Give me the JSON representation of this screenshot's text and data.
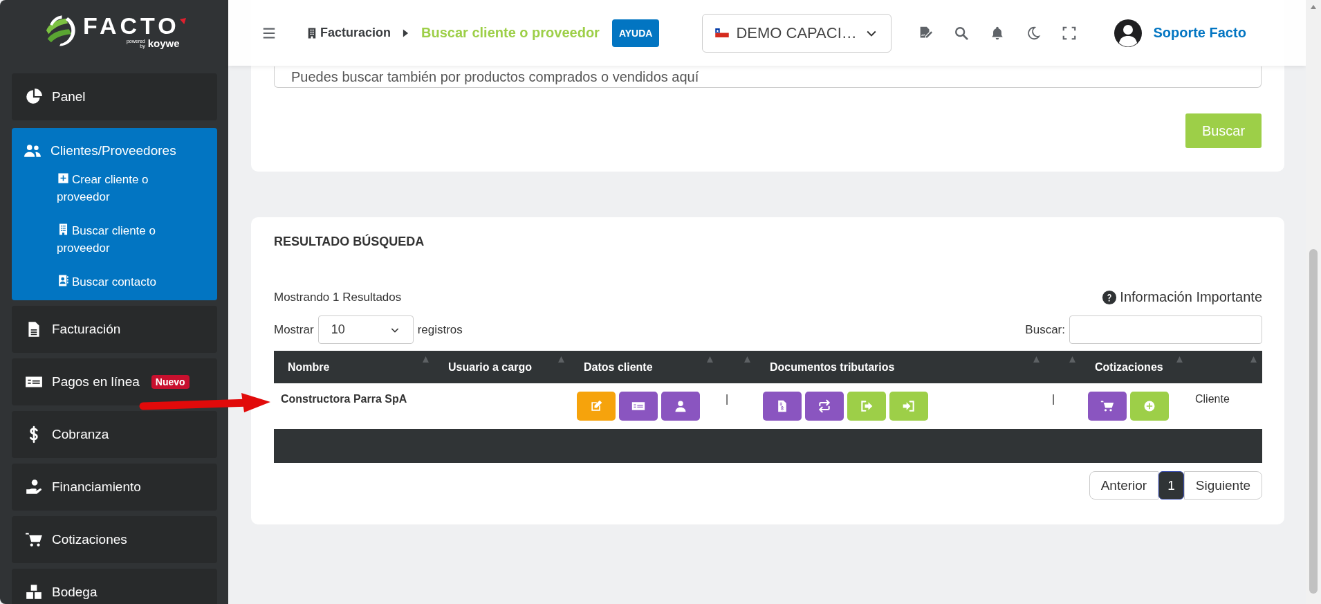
{
  "logo": {
    "name": "FACTO",
    "powered": "powered by",
    "brand": "koywe"
  },
  "sidebar": {
    "items": [
      {
        "label": "Panel",
        "selected": false,
        "expanded": false
      },
      {
        "label": "Clientes/Proveedores",
        "selected": true,
        "expanded": true,
        "children": [
          {
            "label": "Crear cliente o proveedor"
          },
          {
            "label": "Buscar cliente o proveedor"
          },
          {
            "label": "Buscar contacto"
          }
        ]
      },
      {
        "label": "Facturación",
        "selected": false,
        "expanded": false
      },
      {
        "label": "Pagos en línea",
        "selected": false,
        "expanded": false,
        "badge": "Nuevo"
      },
      {
        "label": "Cobranza",
        "selected": false,
        "expanded": false
      },
      {
        "label": "Financiamiento",
        "selected": false,
        "expanded": false
      },
      {
        "label": "Cotizaciones",
        "selected": false,
        "expanded": false
      },
      {
        "label": "Bodega",
        "selected": false,
        "expanded": false
      }
    ]
  },
  "header": {
    "breadcrumb": {
      "parent": "Facturacion",
      "current": "Buscar cliente o proveedor"
    },
    "help_button": "AYUDA",
    "company": "DEMO CAPACI…",
    "user": "Soporte Facto"
  },
  "search_card": {
    "placeholder": "Puedes buscar también por productos comprados o vendidos aquí",
    "button": "Buscar"
  },
  "results": {
    "title": "RESULTADO BÚSQUEDA",
    "summary": "Mostrando 1 Resultados",
    "info": "Información Importante",
    "length_label": "Mostrar",
    "length_value": "10",
    "length_suffix": "registros",
    "search_label": "Buscar:",
    "table": {
      "columns": [
        {
          "label": "Nombre"
        },
        {
          "label": "Usuario a cargo"
        },
        {
          "label": "Datos cliente"
        },
        {},
        {
          "label": "Documentos tributarios"
        },
        {},
        {
          "label": "Cotizaciones"
        },
        {}
      ],
      "rows": [
        {
          "nombre": "Constructora Parra SpA",
          "datos_cliente": [
            {
              "kind": "edit",
              "color": "#f6a30c"
            },
            {
              "kind": "money-card",
              "color": "#8a55c0"
            },
            {
              "kind": "user",
              "color": "#8a55c0"
            }
          ],
          "column_4": "|",
          "documentos": [
            {
              "kind": "file-dollar",
              "color": "#8a55c0"
            },
            {
              "kind": "exchange",
              "color": "#8a55c0"
            },
            {
              "kind": "sign-out",
              "color": "#9dcf48"
            },
            {
              "kind": "sign-in",
              "color": "#9dcf48"
            }
          ],
          "column_6": "|",
          "cotizaciones": [
            {
              "kind": "cart",
              "color": "#8a55c0"
            },
            {
              "kind": "plus-circle",
              "color": "#9dcf48"
            }
          ],
          "column_8": "Cliente"
        }
      ]
    },
    "pagination": [
      {
        "label": "Anterior",
        "selected": false
      },
      {
        "label": "1",
        "selected": true
      },
      {
        "label": "Siguiente",
        "selected": false
      }
    ]
  }
}
